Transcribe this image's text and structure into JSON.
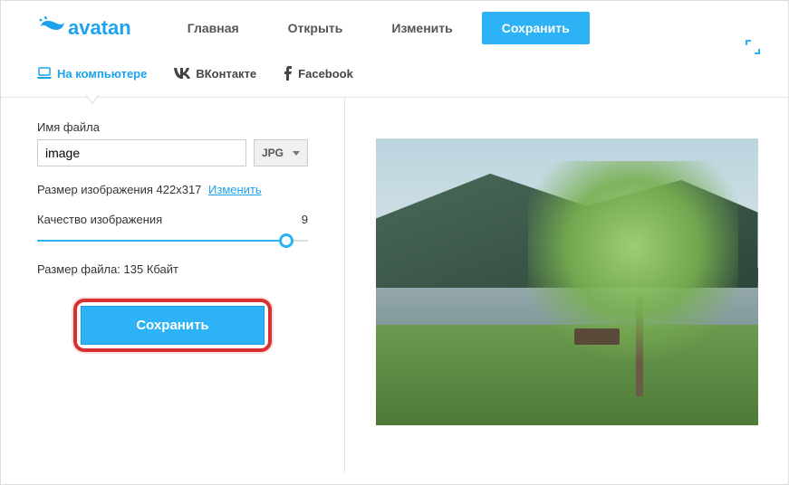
{
  "logo": "avatan",
  "nav": {
    "home": "Главная",
    "open": "Открыть",
    "edit": "Изменить",
    "save": "Сохранить"
  },
  "tabs": {
    "computer": "На компьютере",
    "vk": "ВКонтакте",
    "fb": "Facebook"
  },
  "panel": {
    "filename_label": "Имя файла",
    "filename_value": "image",
    "format": "JPG",
    "size_label": "Размер изображения 422x317",
    "size_change": "Изменить",
    "quality_label": "Качество изображения",
    "quality_value": "9",
    "filesize": "Размер файла: 135 Кбайт",
    "save_btn": "Сохранить"
  }
}
